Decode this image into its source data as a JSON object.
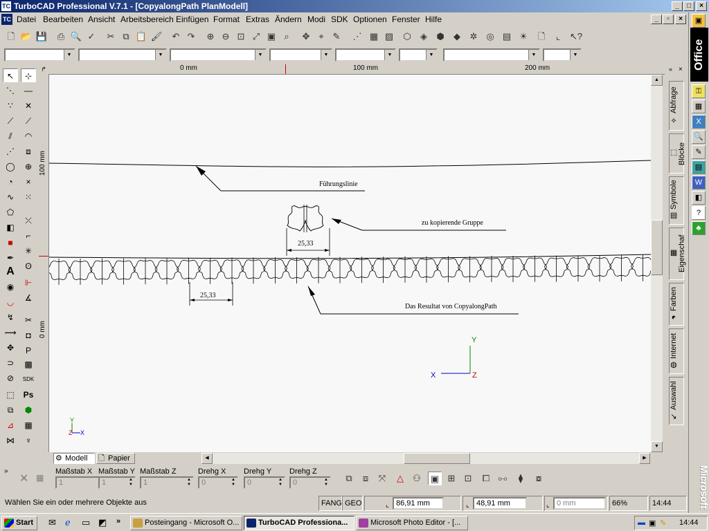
{
  "window": {
    "title": "TurboCAD Professional V.7.1 - [CopyalongPath PlanModell]",
    "app_icon": "TC"
  },
  "menu": [
    "Datei",
    "Bearbeiten",
    "Ansicht",
    "Arbeitsbereich",
    "Einfügen",
    "Format",
    "Extras",
    "Ändern",
    "Modi",
    "SDK",
    "Optionen",
    "Fenster",
    "Hilfe"
  ],
  "office_bar": {
    "label": "Office",
    "footer": "Microsoft"
  },
  "rulers": {
    "horizontal": [
      "0 mm",
      "100 mm",
      "200 mm"
    ],
    "vertical": [
      "100 mm",
      "0 mm"
    ]
  },
  "side_tabs": [
    "Abfrage",
    "Blöcke",
    "Symbole",
    "Eigenschaf",
    "Farben",
    "Internet",
    "Auswahl"
  ],
  "drawing": {
    "label_guide": "Führungslinie",
    "label_group": "zu kopierende Gruppe",
    "label_result": "Das Resultat von CopyalongPath",
    "dim_top": "25,33",
    "dim_bottom": "25,33",
    "axis_y": "Y",
    "axis_x": "X",
    "axis_z": "Z"
  },
  "page_tabs": [
    "Modell",
    "Papier"
  ],
  "inspector": {
    "fields": [
      {
        "label": "Maßstab X",
        "value": "1"
      },
      {
        "label": "Maßstab Y",
        "value": "1"
      },
      {
        "label": "Maßstab Z",
        "value": "1"
      },
      {
        "label": "Drehg X",
        "value": "0"
      },
      {
        "label": "Drehg Y",
        "value": "0"
      },
      {
        "label": "Drehg Z",
        "value": "0"
      }
    ]
  },
  "status": {
    "message": "Wählen Sie ein oder mehrere Objekte aus",
    "fang": "FANG",
    "geo": "GEO",
    "x": "86,91 mm",
    "y": "48,91 mm",
    "z": "0 mm",
    "zoom": "66%",
    "time": "14:44"
  },
  "taskbar": {
    "start": "Start",
    "tasks": [
      "Posteingang - Microsoft O...",
      "TurboCAD Professiona...",
      "Microsoft Photo Editor - [..."
    ],
    "clock": "14:44",
    "quick_launch_more": "»"
  },
  "toolbar_icons": [
    "new-file-icon",
    "open-folder-icon",
    "save-icon",
    "print-icon",
    "print-preview-icon",
    "spellcheck-icon",
    "cut-icon",
    "copy-icon",
    "paste-icon",
    "format-painter-icon",
    "undo-icon",
    "redo-icon",
    "zoom-in-icon",
    "zoom-out-icon",
    "zoom-window-icon",
    "zoom-extents-icon",
    "zoom-page-icon",
    "zoom-previous-icon",
    "pan-icon",
    "snap-icon",
    "pencil-icon",
    "grid-icon",
    "layer-icon",
    "3d-view-icon",
    "render-icon",
    "wireframe-icon",
    "hatch-icon",
    "blocks-icon",
    "page-icon",
    "snap-corner-icon",
    "help-pointer-icon"
  ]
}
